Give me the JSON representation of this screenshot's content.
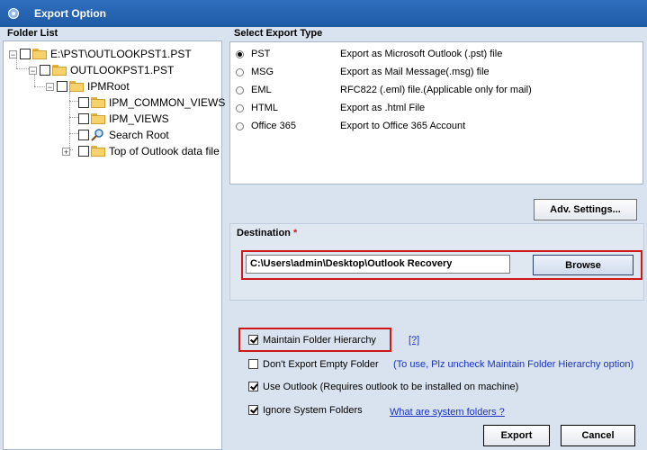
{
  "window": {
    "title": "Export Option"
  },
  "folder_list": {
    "label": "Folder List",
    "nodes": [
      {
        "label": "E:\\PST\\OUTLOOKPST1.PST",
        "icon": "folder-open-icon"
      },
      {
        "label": "OUTLOOKPST1.PST",
        "icon": "pst-file-icon"
      },
      {
        "label": "IPMRoot",
        "icon": "folder-icon"
      },
      {
        "label": "IPM_COMMON_VIEWS",
        "icon": "folder-icon"
      },
      {
        "label": "IPM_VIEWS",
        "icon": "folder-icon"
      },
      {
        "label": "Search Root",
        "icon": "search-icon"
      },
      {
        "label": "Top of Outlook data file",
        "icon": "folder-icon"
      }
    ]
  },
  "export_type": {
    "label": "Select Export Type",
    "selected": "PST",
    "options": [
      {
        "name": "PST",
        "desc": "Export as Microsoft Outlook (.pst) file"
      },
      {
        "name": "MSG",
        "desc": "Export as Mail Message(.msg) file"
      },
      {
        "name": "EML",
        "desc": "RFC822 (.eml) file.(Applicable only for mail)"
      },
      {
        "name": "HTML",
        "desc": "Export as .html File"
      },
      {
        "name": "Office 365",
        "desc": "Export to Office 365 Account"
      }
    ]
  },
  "adv_settings_label": "Adv. Settings...",
  "destination": {
    "label": "Destination",
    "required_mark": "*",
    "path": "C:\\Users\\admin\\Desktop\\Outlook Recovery",
    "browse_label": "Browse"
  },
  "options": {
    "maintain_hierarchy": {
      "label": "Maintain Folder Hierarchy",
      "checked": true,
      "help": "[?]"
    },
    "dont_export_empty": {
      "label": "Don't Export Empty Folder",
      "checked": false,
      "note": "(To use, Plz uncheck Maintain Folder Hierarchy option)"
    },
    "use_outlook": {
      "label": "Use Outlook (Requires outlook to be installed on machine)",
      "checked": true
    },
    "ignore_system": {
      "label": "Ignore System Folders",
      "checked": true,
      "link": "What are system folders ?"
    }
  },
  "buttons": {
    "export": "Export",
    "cancel": "Cancel"
  },
  "colors": {
    "title_bar": "#1e5aa6",
    "highlight_border": "#d01818",
    "link": "#1a33c4"
  }
}
